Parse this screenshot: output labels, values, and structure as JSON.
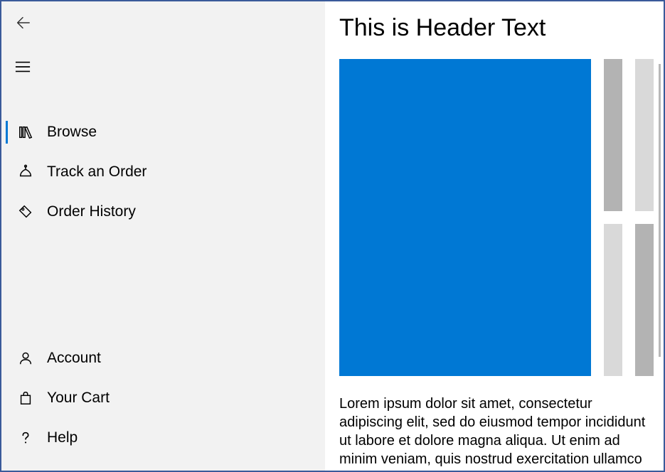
{
  "sidebar": {
    "nav_top": [
      {
        "label": "Browse",
        "icon": "library",
        "selected": true
      },
      {
        "label": "Track an Order",
        "icon": "package",
        "selected": false
      },
      {
        "label": "Order History",
        "icon": "tags",
        "selected": false
      }
    ],
    "nav_bottom": [
      {
        "label": "Account",
        "icon": "person",
        "selected": false
      },
      {
        "label": "Your Cart",
        "icon": "bag",
        "selected": false
      },
      {
        "label": "Help",
        "icon": "question",
        "selected": false
      }
    ]
  },
  "main": {
    "header": "This is Header Text",
    "body_text": "Lorem ipsum dolor sit amet, consectetur adipiscing elit, sed do eiusmod tempor incididunt ut labore et dolore magna aliqua. Ut enim ad minim veniam, quis nostrud exercitation ullamco",
    "colors": {
      "accent": "#0078d4",
      "block_gray": "#b3b3b3",
      "block_lightgray": "#d9d9d9"
    }
  }
}
